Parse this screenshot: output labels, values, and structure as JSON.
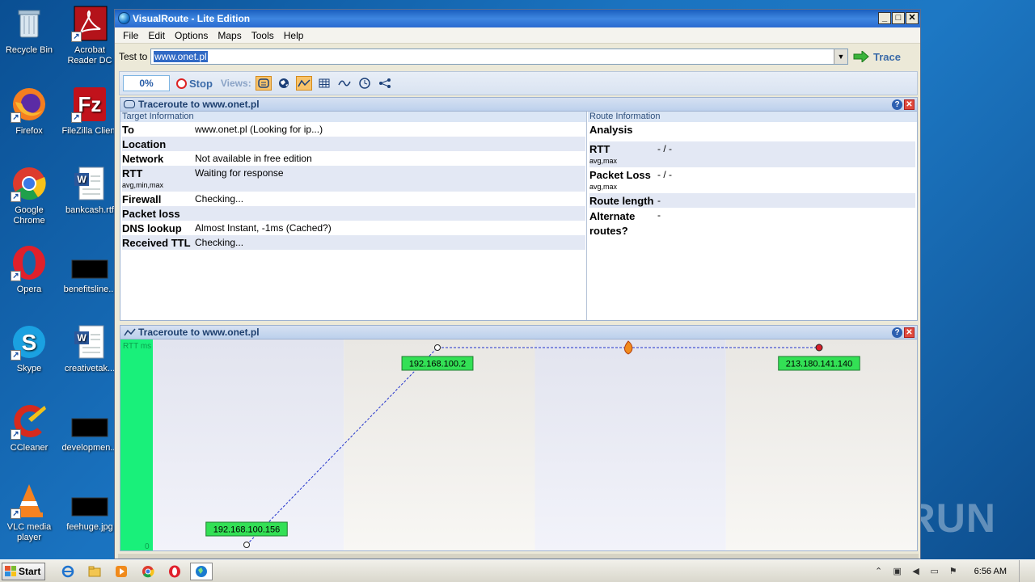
{
  "desktop": {
    "icons": [
      {
        "label": "Recycle Bin",
        "icon": "recycle-bin-icon"
      },
      {
        "label": "Acrobat Reader DC",
        "icon": "acrobat-icon"
      },
      {
        "label": "Firefox",
        "icon": "firefox-icon"
      },
      {
        "label": "FileZilla Client",
        "icon": "filezilla-icon"
      },
      {
        "label": "Google Chrome",
        "icon": "chrome-icon"
      },
      {
        "label": "bankcash.rtf",
        "icon": "word-doc-icon"
      },
      {
        "label": "Opera",
        "icon": "opera-icon"
      },
      {
        "label": "benefitsline...",
        "icon": "black-file-icon"
      },
      {
        "label": "Skype",
        "icon": "skype-icon"
      },
      {
        "label": "creativetak...",
        "icon": "word-doc-icon"
      },
      {
        "label": "CCleaner",
        "icon": "ccleaner-icon"
      },
      {
        "label": "developmen...",
        "icon": "black-file-icon"
      },
      {
        "label": "VLC media player",
        "icon": "vlc-icon"
      },
      {
        "label": "feehuge.jpg",
        "icon": "black-file-icon"
      }
    ],
    "watermark": "ANY RUN"
  },
  "window": {
    "title": "VisualRoute - Lite Edition",
    "menu": [
      "File",
      "Edit",
      "Options",
      "Maps",
      "Tools",
      "Help"
    ],
    "test_to_label": "Test to",
    "test_to_value": "www.onet.pl",
    "trace_label": "Trace",
    "progress": "0%",
    "stop_label": "Stop",
    "views_label": "Views:",
    "view_icons": [
      "panel-view-icon",
      "globe-icon",
      "graph-icon",
      "table-icon",
      "wave-icon",
      "clock-icon",
      "network-icon"
    ]
  },
  "info_panel": {
    "title": "Traceroute to www.onet.pl",
    "target_header": "Target Information",
    "route_header": "Route Information",
    "target_rows": [
      {
        "key": "To",
        "value": "www.onet.pl (Looking for ip...)",
        "sub": ""
      },
      {
        "key": "Location",
        "value": "",
        "sub": ""
      },
      {
        "key": "Network",
        "value": "Not available in free edition",
        "sub": ""
      },
      {
        "key": "RTT",
        "value": "Waiting for response",
        "sub": "avg,min,max"
      },
      {
        "key": "Firewall",
        "value": "Checking...",
        "sub": ""
      },
      {
        "key": "Packet loss",
        "value": "",
        "sub": ""
      },
      {
        "key": "DNS lookup",
        "value": "Almost Instant, -1ms (Cached?)",
        "sub": ""
      },
      {
        "key": "Received TTL",
        "value": "Checking...",
        "sub": ""
      }
    ],
    "route_rows": [
      {
        "key": "Analysis",
        "value": "",
        "sub": ""
      },
      {
        "key": "RTT",
        "value": "- / -",
        "sub": "avg,max"
      },
      {
        "key": "Packet Loss",
        "value": "- / -",
        "sub": "avg,max"
      },
      {
        "key": "Route length",
        "value": "-",
        "sub": ""
      },
      {
        "key": "Alternate routes?",
        "value": "-",
        "sub": ""
      }
    ]
  },
  "graph_panel": {
    "title": "Traceroute to www.onet.pl",
    "y_axis_label": "RTT ms",
    "y_zero_label": "0",
    "hops": [
      {
        "label": "192.168.100.156",
        "rtt_level": 0.0,
        "hop_index": 0
      },
      {
        "label": "192.168.100.2",
        "rtt_level": 1.0,
        "hop_index": 1
      },
      {
        "label": "",
        "rtt_level": 1.0,
        "hop_index": 2,
        "icon": "firewall-flame-icon"
      },
      {
        "label": "213.180.141.140",
        "rtt_level": 1.0,
        "hop_index": 3,
        "destination": true
      }
    ],
    "colors": {
      "hop_box": "#33e055",
      "axis_bar": "#19f07a",
      "link": "#2233cc",
      "destination": "#d8202a"
    }
  },
  "taskbar": {
    "start_label": "Start",
    "apps": [
      "ie-icon",
      "explorer-icon",
      "media-player-icon",
      "chrome-icon",
      "opera-icon",
      "visualroute-icon"
    ],
    "clock": "6:56 AM"
  }
}
